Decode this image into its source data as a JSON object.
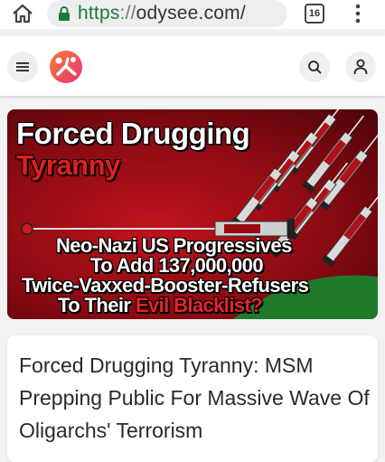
{
  "browser": {
    "url_scheme": "https",
    "url_sep": "://",
    "url_host": "odysee.com/",
    "tab_count": "16"
  },
  "header": {
    "menu_icon": "hamburger-icon",
    "logo_icon": "odysee-logo",
    "search_icon": "search-icon",
    "account_icon": "user-icon"
  },
  "thumbnail": {
    "title_line1": "Forced Drugging",
    "title_line2": "Tyranny",
    "line1": "Neo-Nazi US Progressives",
    "line2": "To Add 137,000,000",
    "line3": "Twice-Vaxxed-Booster-Refusers",
    "line4_white": "To Their ",
    "line4_red": "Evil Blacklist?"
  },
  "video": {
    "title": "Forced Drugging Tyranny: MSM Prepping Public For Massive Wave Of Oligarchs' Terrorism"
  },
  "colors": {
    "url_scheme": "#1b7a3a",
    "thumbnail_red": "#c0141d",
    "logo_orange": "#f25a3c",
    "logo_pink": "#e8336d"
  }
}
